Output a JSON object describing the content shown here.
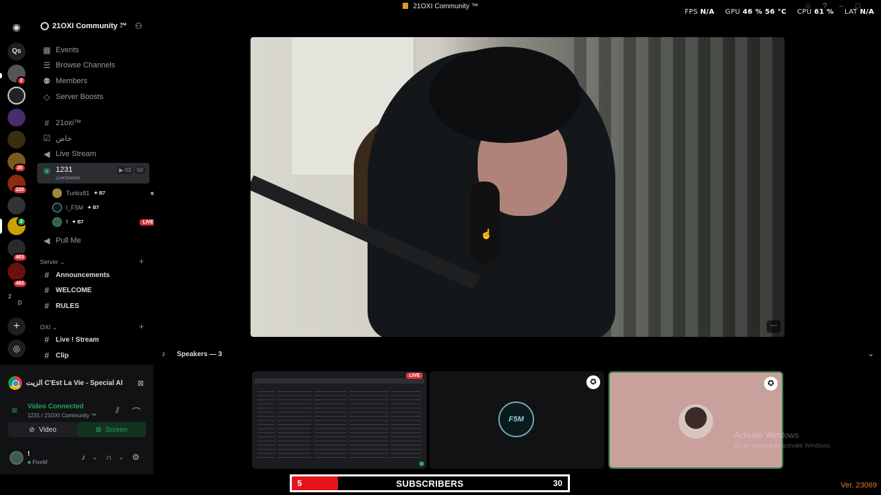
{
  "window": {
    "title": "21OXI Community ™",
    "hud": {
      "fps_label": "FPS",
      "fps": "N/A",
      "gpu_label": "GPU",
      "gpu": "46 %  56 °C",
      "cpu_label": "CPU",
      "cpu": "61 %",
      "lat_label": "LAT",
      "lat": "N/A"
    }
  },
  "rail": {
    "badges": [
      "2",
      "20",
      "220",
      "2",
      "403",
      "483"
    ],
    "folder_label_1": "2",
    "folder_label_2": "D",
    "qs_label": "Qs"
  },
  "guild": {
    "name": "21OXI Community ™",
    "menu": [
      "Events",
      "Browse Channels",
      "Members",
      "Server Boosts"
    ],
    "channels_top": [
      {
        "name": "21oxi™",
        "icon": "hash"
      },
      {
        "name": "خاص",
        "icon": "check"
      },
      {
        "name": "Live Stream",
        "icon": "speaker"
      }
    ],
    "voice_channel": {
      "name": "1231",
      "sub": "LiveStream",
      "video_count": "03",
      "user_limit": "50",
      "users": [
        {
          "name": "Turkix81",
          "tag": "B7",
          "has_cam": true
        },
        {
          "name": "l_F5M",
          "tag": "B7",
          "has_cam": false
        },
        {
          "name": "!",
          "tag": "B7",
          "live": "LIVE"
        }
      ]
    },
    "pull_me": "Pull Me",
    "categories": [
      {
        "name": "Server",
        "channels": [
          "Announcements",
          "WELCOME",
          "RULES"
        ]
      },
      {
        "name": "OXI",
        "channels": [
          "Live ! Stream",
          "Clip"
        ]
      }
    ]
  },
  "panel": {
    "activity": "الزيت C'Est La Vie - Special Al...",
    "voice_connected": "Video Connected",
    "voice_sub": "1231 / 21OXI Community ™",
    "video_label": "Video",
    "screen_label": "Screen",
    "user_name": "!",
    "user_status": "FiveM"
  },
  "stage": {
    "speakers_label": "Speakers — 3",
    "live_badge": "LIVE",
    "f5m_logo": "F5M",
    "watermark_title": "Activate Windows",
    "watermark_sub": "Go to Settings to activate Windows."
  },
  "subscribers": {
    "current": "5",
    "label": "SUBSCRIBERS",
    "goal": "30",
    "progress_fraction": 0.1667
  },
  "version": "Ver. 23069",
  "colors": {
    "accent_green": "#23a559",
    "live_red": "#da373c",
    "sub_red": "#e6131c",
    "version_orange": "#e8742c"
  }
}
